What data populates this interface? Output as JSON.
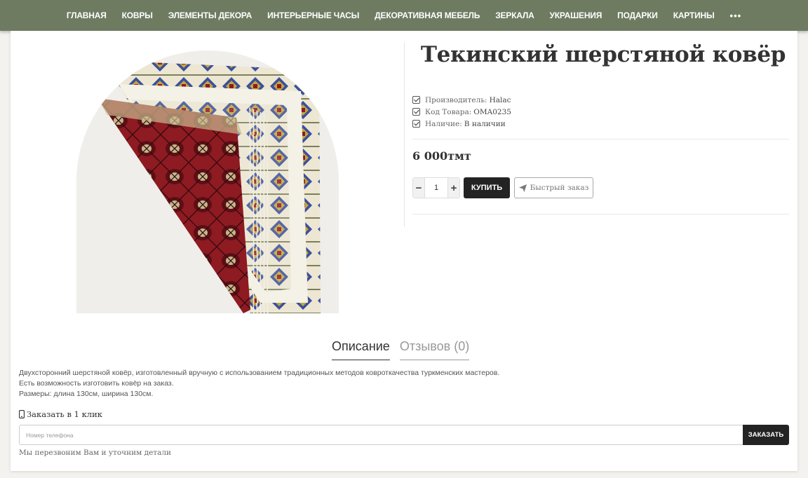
{
  "nav": {
    "items": [
      "ГЛАВНАЯ",
      "КОВРЫ",
      "ЭЛЕМЕНТЫ ДЕКОРА",
      "ИНТЕРЬЕРНЫЕ ЧАСЫ",
      "ДЕКОРАТИВНАЯ МЕБЕЛЬ",
      "ЗЕРКАЛА",
      "УКРАШЕНИЯ",
      "ПОДАРКИ",
      "КАРТИНЫ"
    ],
    "more": "•••"
  },
  "product": {
    "title": "Текинский шерстяной ковёр",
    "specs": [
      {
        "label": "Производитель:",
        "value": "Halac"
      },
      {
        "label": "Код Товара:",
        "value": "OMA0235"
      },
      {
        "label": "Наличие:",
        "value": "В наличии"
      }
    ],
    "price": "6 000тмт",
    "quantity": "1",
    "buy_label": "КУПИТЬ",
    "quick_order_label": "Быстрый заказ",
    "image_alt": "carpet-photo"
  },
  "tabs": [
    {
      "label": "Описание",
      "active": true
    },
    {
      "label": "Отзывов (0)",
      "active": false
    }
  ],
  "description": [
    "Двухсторонний шерстяной ковёр, изготовленный вручную с использованием традиционных методов ковроткачества туркменских мастеров.",
    "Есть возможность изготовить ковёр на заказ.",
    "Размеры: длина 130см, ширина 130см."
  ],
  "one_click": {
    "label": "Заказать в 1 клик",
    "placeholder": "Номер телефона",
    "submit_label": "ЗАКАЗАТЬ",
    "note": "Мы перезвоним Вам и уточним детали"
  },
  "colors": {
    "nav_bg": "#6f7b61",
    "carpet_red": "#8e1a22",
    "carpet_border": "#e9e2cf",
    "button_dark": "#232323"
  }
}
